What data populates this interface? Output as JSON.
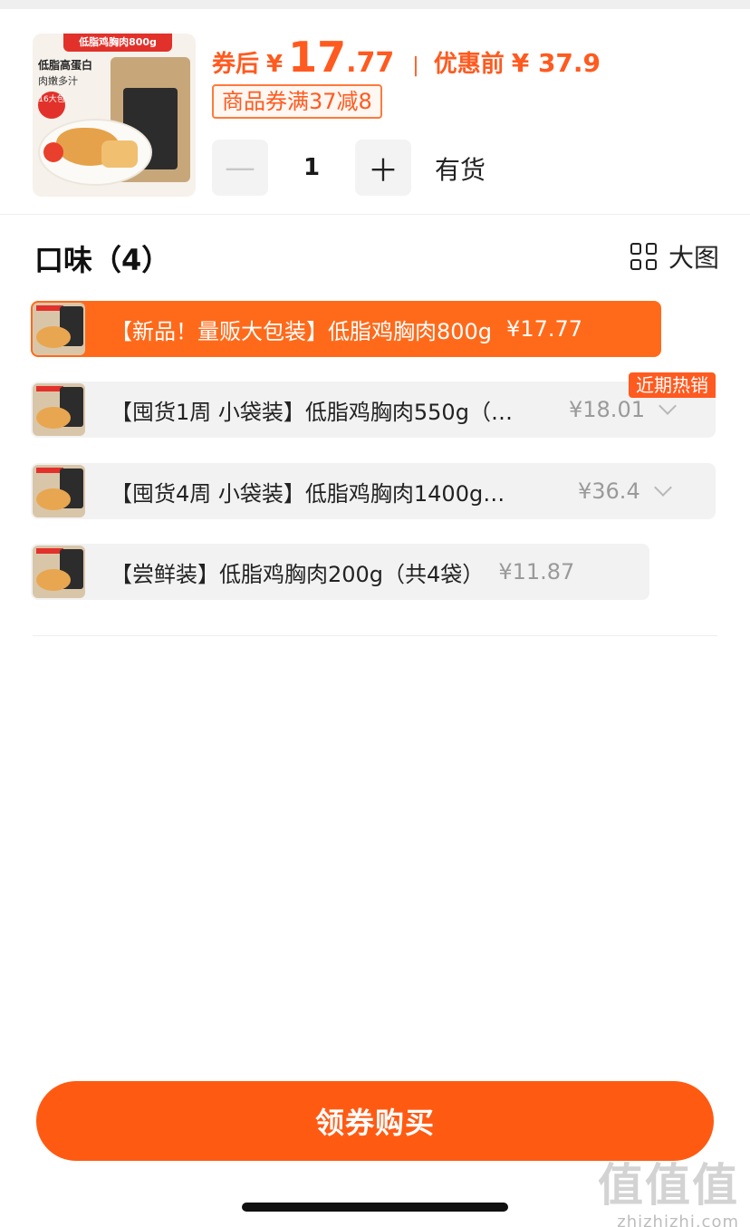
{
  "product": {
    "thumb_banner": "低脂鸡胸肉800g",
    "thumb_line1": "低脂高蛋白",
    "thumb_line2": "肉嫩多汁",
    "thumb_badge": "16大包",
    "after_coupon_label": "券后",
    "currency": "¥",
    "price_int": "17",
    "price_dec": ".77",
    "separator": "|",
    "before_label": "优惠前",
    "original_price": "¥ 37.9",
    "coupon_text": "商品券满37减8"
  },
  "stepper": {
    "minus": "—",
    "quantity": "1",
    "plus": "＋",
    "stock": "有货"
  },
  "flavor": {
    "title": "口味（4）",
    "big_view_label": "大图"
  },
  "options": [
    {
      "name": "【新品！量贩大包装】低脂鸡胸肉800g",
      "price": "¥17.77",
      "selected": true
    },
    {
      "name": "【囤货1周 小袋装】低脂鸡胸肉550g（…",
      "price": "¥18.01",
      "tag": "近期热销"
    },
    {
      "name": "【囤货4周 小袋装】低脂鸡胸肉1400g…",
      "price": "¥36.4"
    },
    {
      "name": "【尝鲜装】低脂鸡胸肉200g（共4袋）",
      "price": "¥11.87"
    }
  ],
  "buy_button": "领券购买",
  "watermark": {
    "logo": "值值值",
    "site": "zhizhizhi.com"
  },
  "colors": {
    "accent": "#ff5a1f",
    "button": "#ff5a12",
    "pill_bg": "#f2f2f2"
  }
}
